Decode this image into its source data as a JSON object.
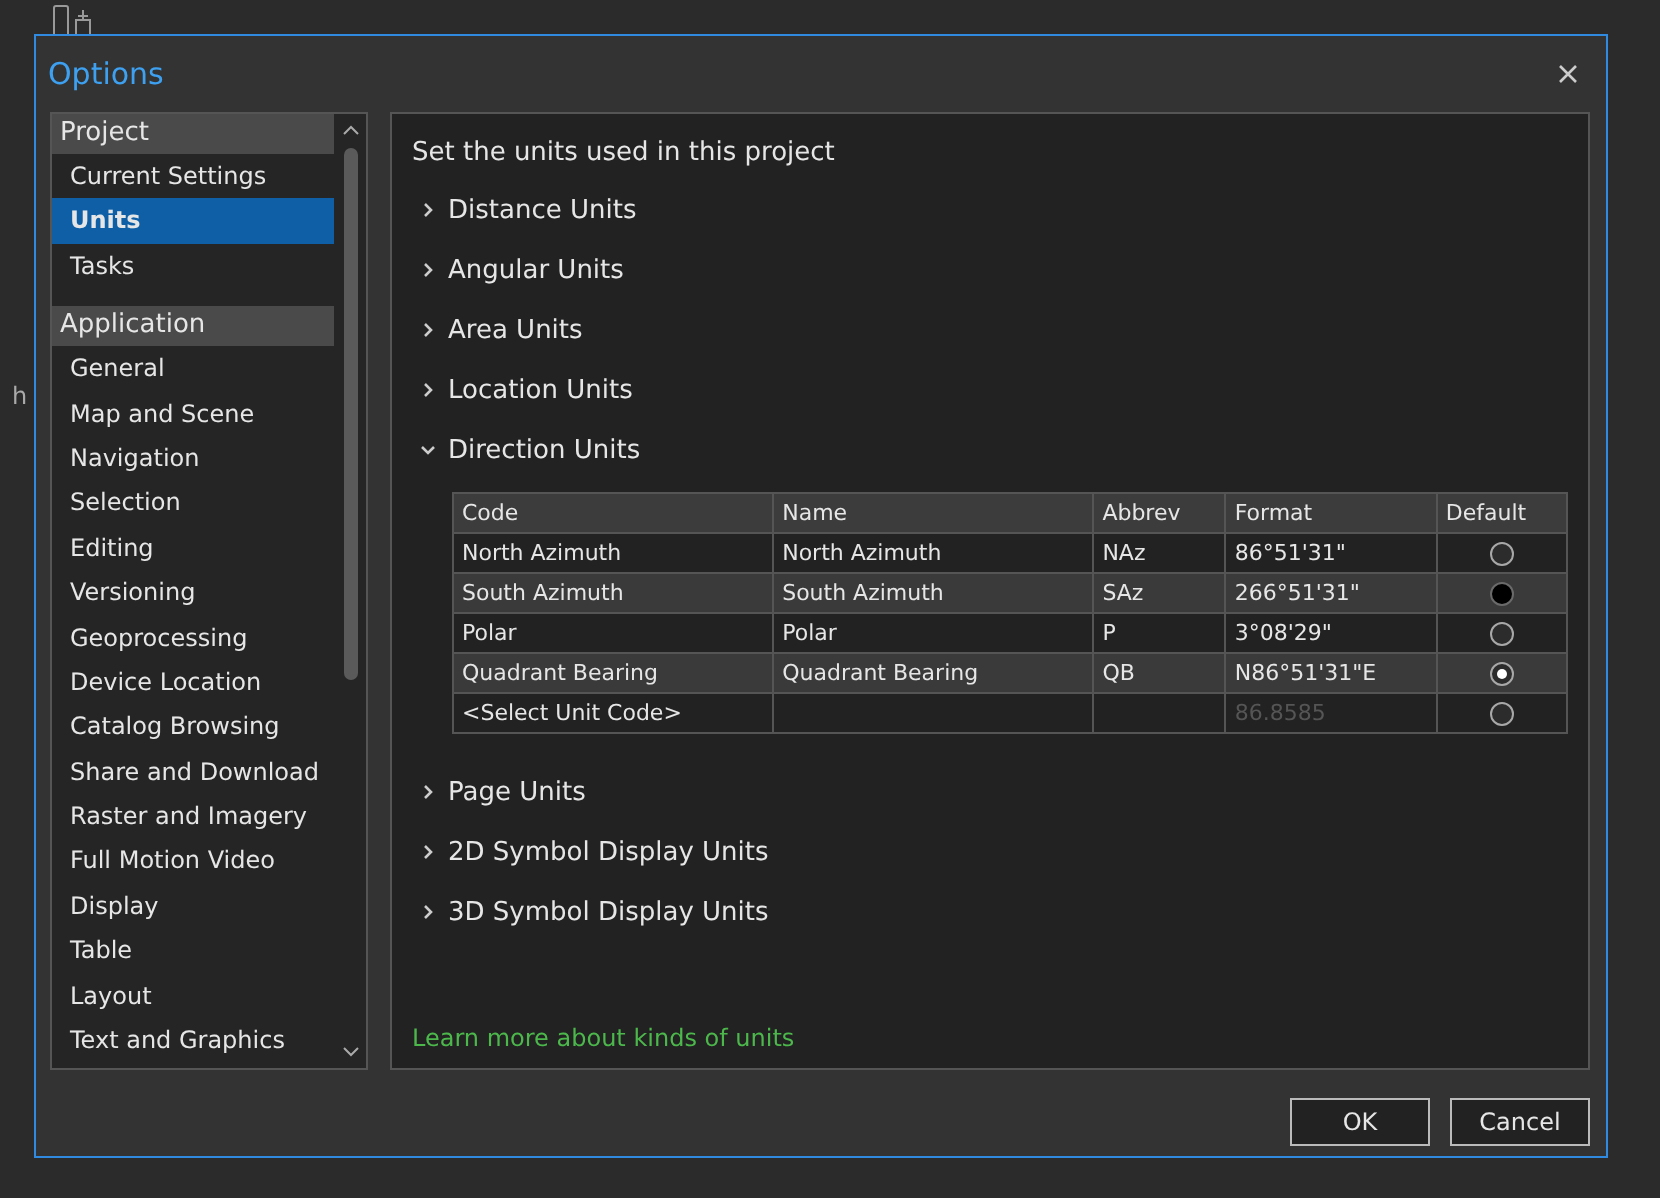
{
  "background": {
    "text": "h"
  },
  "window": {
    "title": "Options"
  },
  "sidebar": {
    "groups": [
      {
        "header": "Project",
        "items": [
          {
            "label": "Current Settings",
            "selected": false
          },
          {
            "label": "Units",
            "selected": true
          },
          {
            "label": "Tasks",
            "selected": false
          }
        ]
      },
      {
        "header": "Application",
        "items": [
          {
            "label": "General",
            "selected": false
          },
          {
            "label": "Map and Scene",
            "selected": false
          },
          {
            "label": "Navigation",
            "selected": false
          },
          {
            "label": "Selection",
            "selected": false
          },
          {
            "label": "Editing",
            "selected": false
          },
          {
            "label": "Versioning",
            "selected": false
          },
          {
            "label": "Geoprocessing",
            "selected": false
          },
          {
            "label": "Device Location",
            "selected": false
          },
          {
            "label": "Catalog Browsing",
            "selected": false
          },
          {
            "label": "Share and Download",
            "selected": false
          },
          {
            "label": "Raster and Imagery",
            "selected": false
          },
          {
            "label": "Full Motion Video",
            "selected": false
          },
          {
            "label": "Display",
            "selected": false
          },
          {
            "label": "Table",
            "selected": false
          },
          {
            "label": "Layout",
            "selected": false
          },
          {
            "label": "Text and Graphics",
            "selected": false
          }
        ]
      }
    ]
  },
  "content": {
    "heading": "Set the units used in this project",
    "sections": [
      {
        "label": "Distance Units",
        "expanded": false
      },
      {
        "label": "Angular Units",
        "expanded": false
      },
      {
        "label": "Area Units",
        "expanded": false
      },
      {
        "label": "Location Units",
        "expanded": false
      },
      {
        "label": "Direction Units",
        "expanded": true,
        "table": {
          "columns": [
            "Code",
            "Name",
            "Abbrev",
            "Format",
            "Default"
          ],
          "rows": [
            {
              "kind": "unit",
              "code": "North Azimuth",
              "name": "North Azimuth",
              "abbrev": "NAz",
              "format": "86°51'31\"",
              "selected": false,
              "hovered": false
            },
            {
              "kind": "unit",
              "code": "South Azimuth",
              "name": "South Azimuth",
              "abbrev": "SAz",
              "format": "266°51'31\"",
              "selected": false,
              "hovered": true
            },
            {
              "kind": "unit",
              "code": "Polar",
              "name": "Polar",
              "abbrev": "P",
              "format": "3°08'29\"",
              "selected": false,
              "hovered": false
            },
            {
              "kind": "unit",
              "code": "Quadrant Bearing",
              "name": "Quadrant Bearing",
              "abbrev": "QB",
              "format": "N86°51'31\"E",
              "selected": true,
              "hovered": false
            },
            {
              "kind": "new",
              "code": "<Select Unit Code>",
              "format": "86.8585",
              "selected": false,
              "hovered": false
            }
          ]
        }
      },
      {
        "label": "Page Units",
        "expanded": false
      },
      {
        "label": "2D Symbol Display Units",
        "expanded": false
      },
      {
        "label": "3D Symbol Display Units",
        "expanded": false
      }
    ],
    "link": "Learn more about kinds of units"
  },
  "buttons": [
    "OK",
    "Cancel"
  ]
}
